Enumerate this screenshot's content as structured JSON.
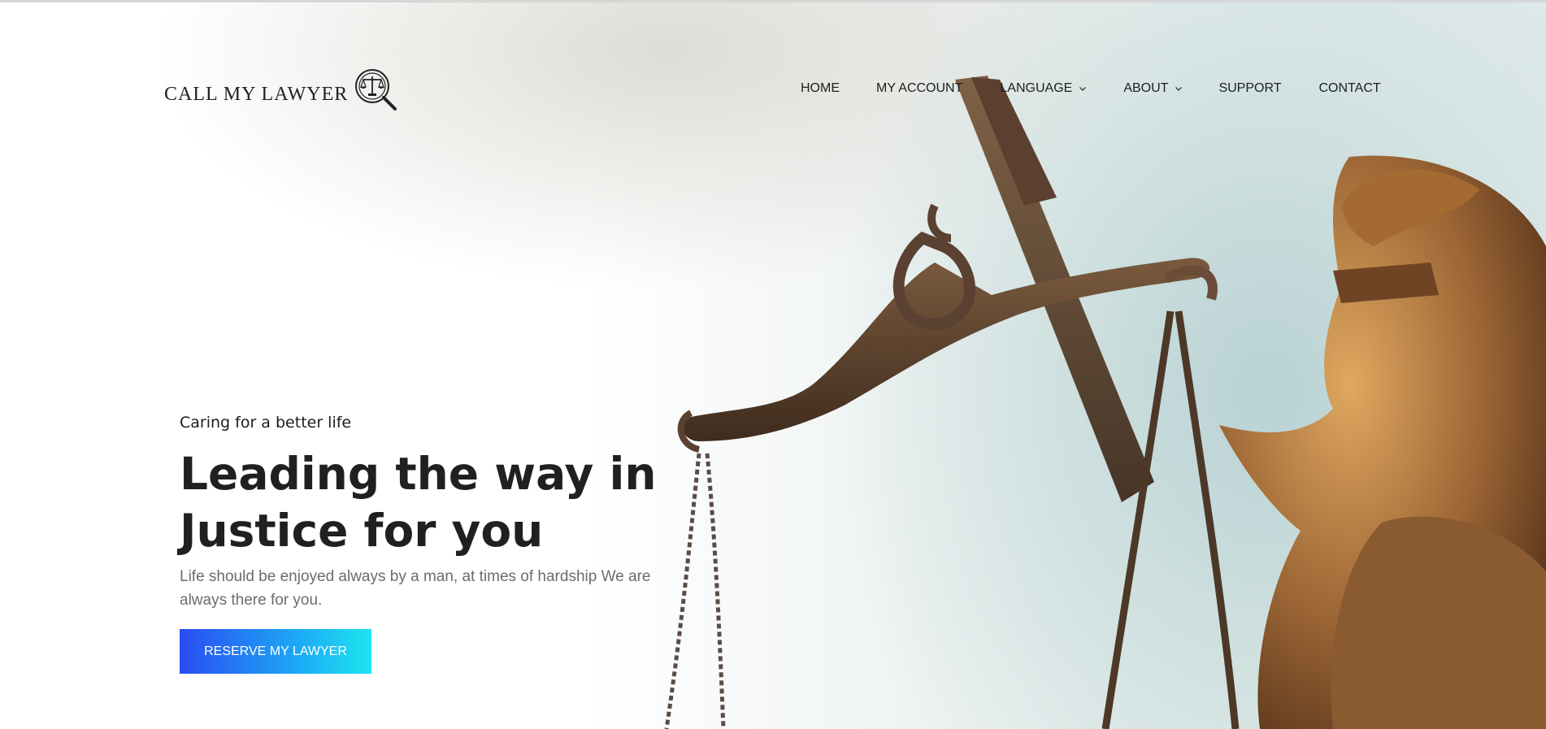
{
  "brand": {
    "name": "CALL MY LAWYER",
    "logo_icon": "scales-magnifier-icon"
  },
  "nav": {
    "items": [
      {
        "label": "HOME",
        "has_dropdown": false
      },
      {
        "label": "MY ACCOUNT",
        "has_dropdown": false
      },
      {
        "label": "LANGUAGE",
        "has_dropdown": true
      },
      {
        "label": "ABOUT",
        "has_dropdown": true
      },
      {
        "label": "SUPPORT",
        "has_dropdown": false
      },
      {
        "label": "CONTACT",
        "has_dropdown": false
      }
    ]
  },
  "hero": {
    "tagline": "Caring for a better life",
    "headline": "Leading the way in Justice for you",
    "lead": "Life should be enjoyed always by a man, at times of hardship We are always there for you.",
    "cta_label": "RESERVE MY LAWYER",
    "background": "justice-statue-image"
  },
  "colors": {
    "cta_start": "#2a4cf2",
    "cta_end": "#1ee4f0",
    "text_dark": "#202020",
    "text_muted": "#6c6c6c"
  }
}
